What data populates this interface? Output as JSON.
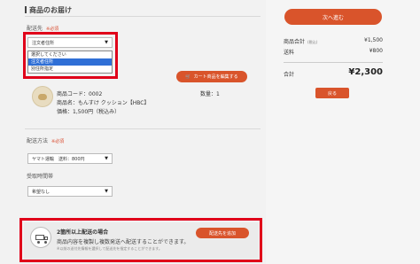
{
  "section": {
    "title": "商品のお届け"
  },
  "delivery_address": {
    "label": "配送先",
    "required": "※必須",
    "selected": "注文者住所",
    "options": [
      "選択してください",
      "注文者住所",
      "別住所指定"
    ]
  },
  "cart": {
    "edit_button": "カート商品を編集する"
  },
  "product": {
    "code": "商品コード：0002",
    "name": "商品名：もんすけ クッション【HBC】",
    "price": "価格：1,500円（税込み）",
    "quantity": "数量：1"
  },
  "shipping_method": {
    "label": "配送方法",
    "required": "※必須",
    "selected": "ヤマト運輸　送料：800円"
  },
  "receive_time": {
    "label": "受取時間帯",
    "selected": "希望なし"
  },
  "additional": {
    "title": "2箇所以上配送の場合",
    "description": "商品内容を複製し複数発送へ配送することができます。",
    "note": "※以前の送付先情報を選択して配送先を指定することができます。",
    "button": "配送先を追加"
  },
  "summary": {
    "next_button": "次へ進む",
    "subtotal_label": "商品合計",
    "subtotal_note": "(税込)",
    "subtotal_value": "¥1,500",
    "shipping_label": "送料",
    "shipping_value": "¥800",
    "total_label": "合計",
    "total_value": "¥2,300",
    "back_button": "戻る"
  },
  "colors": {
    "accent": "#d9542b",
    "highlight": "#e0001a",
    "selected_option": "#2f6fd6"
  }
}
